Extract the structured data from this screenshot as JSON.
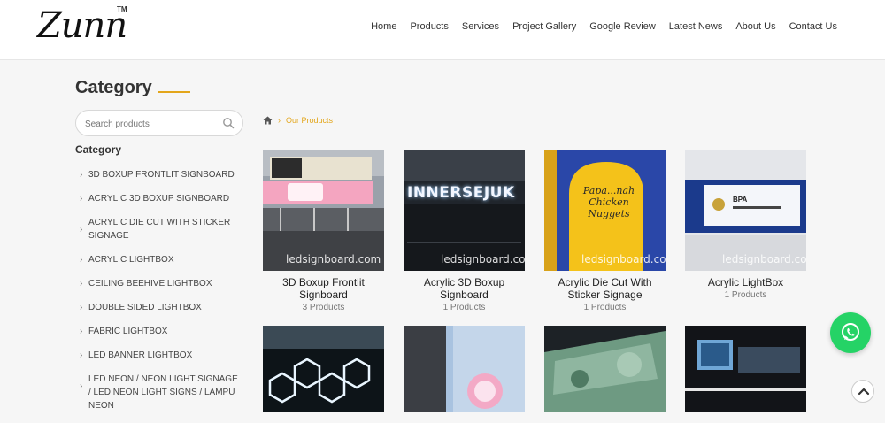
{
  "header": {
    "logo_text": "Zunn",
    "logo_tm": "TM",
    "nav": [
      "Home",
      "Products",
      "Services",
      "Project Gallery",
      "Google Review",
      "Latest News",
      "About Us",
      "Contact Us"
    ]
  },
  "sidebar": {
    "title": "Category",
    "search_placeholder": "Search products",
    "subtitle": "Category",
    "items": [
      "3D BOXUP FRONTLIT SIGNBOARD",
      "ACRYLIC 3D BOXUP SIGNBOARD",
      "ACRYLIC DIE CUT WITH STICKER SIGNAGE",
      "ACRYLIC LIGHTBOX",
      "CEILING BEEHIVE LIGHTBOX",
      "DOUBLE SIDED LIGHTBOX",
      "FABRIC LIGHTBOX",
      "LED BANNER LIGHTBOX",
      "LED NEON / NEON LIGHT SIGNAGE / LED NEON LIGHT SIGNS / LAMPU NEON"
    ]
  },
  "breadcrumb": {
    "current": "Our Products"
  },
  "watermark": "ledsignboard.com",
  "products": [
    {
      "name": "3D Boxup Frontlit Signboard",
      "count": "3 Products"
    },
    {
      "name": "Acrylic 3D Boxup Signboard",
      "count": "1 Products"
    },
    {
      "name": "Acrylic Die Cut With Sticker Signage",
      "count": "1 Products"
    },
    {
      "name": "Acrylic LightBox",
      "count": "1 Products"
    }
  ],
  "photo_text": {
    "p2": "INNERSEJUK",
    "p3": "Papa...nah Chicken Nuggets",
    "p4": "BPA"
  },
  "colors": {
    "accent": "#e3a61b",
    "whatsapp": "#25d366"
  }
}
